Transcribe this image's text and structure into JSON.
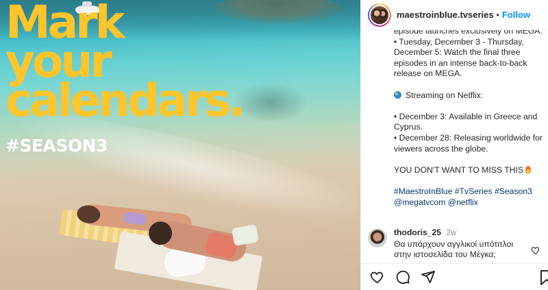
{
  "post_image": {
    "headline_lines": [
      "Mark",
      "your",
      "calendars."
    ],
    "hashtag": "#SEASON3",
    "headline_color": "#ffc52a"
  },
  "header": {
    "username": "maestroinblue.tvseries",
    "separator": "•",
    "follow_label": "Follow",
    "follow_color": "#0095f6"
  },
  "caption": {
    "lines": [
      "episode launches exclusively on MEGA.",
      "• Tuesday, December 3 - Thursday, December 5: Watch the final three episodes in an intense back-to-back release on MEGA.",
      "",
      "Streaming on Netflix:",
      "",
      "• December 3: Available in Greece and Cyprus.",
      "• December 28: Releasing worldwide for viewers across the globe.",
      "",
      "YOU DON'T WANT TO MISS THIS"
    ],
    "hashtags": "#MaestroInBlue #TvSeries #Season3",
    "mentions": "@megatvcom @netflix",
    "icons": {
      "streaming": "globe-icon",
      "miss_this": "fire-icon"
    }
  },
  "comment": {
    "username": "thodoris_25",
    "time": "2w",
    "text": "Θα υπάρχουν αγγλικοί υπότιτλοι στην ιστοσελίδα του Μέγκα;"
  },
  "actions": {
    "icons": [
      "heart-icon",
      "comment-icon",
      "share-icon",
      "bookmark-icon"
    ]
  }
}
